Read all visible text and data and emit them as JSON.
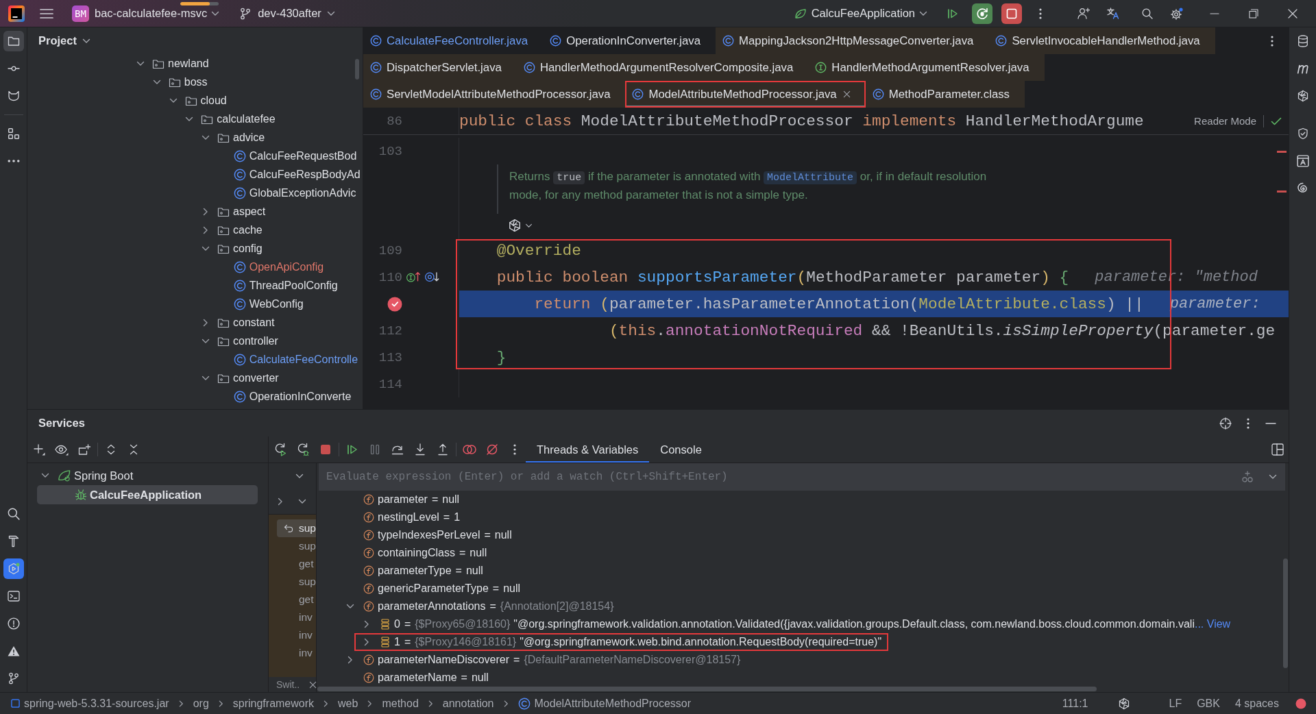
{
  "title_bar": {
    "progress": {
      "level": 0.77
    },
    "project_badge": "BM",
    "project": "bac-calculatefee-msvc",
    "branch": "dev-430after",
    "run_config": "CalcuFeeApplication"
  },
  "left_strip": {
    "top_groups": [
      [
        {
          "kind": "project",
          "selected": true,
          "focused": false
        },
        {
          "kind": "commit",
          "selected": false,
          "focused": false
        },
        {
          "kind": "merge_requests",
          "selected": false,
          "focused": false
        }
      ],
      [
        {
          "kind": "structure",
          "selected": false,
          "focused": false
        },
        {
          "kind": "more",
          "selected": false,
          "focused": false
        }
      ]
    ],
    "bottom": [
      {
        "kind": "search",
        "selected": false,
        "focused": false
      },
      {
        "kind": "build",
        "selected": false,
        "focused": false
      },
      {
        "kind": "services",
        "selected": true,
        "focused": true
      },
      {
        "kind": "terminal",
        "selected": false,
        "focused": false
      },
      {
        "kind": "problems",
        "selected": false,
        "focused": false
      },
      {
        "kind": "warnings",
        "selected": false,
        "focused": false
      },
      {
        "kind": "git",
        "selected": false,
        "focused": false
      }
    ]
  },
  "right_strip": {
    "groups": [
      [
        {
          "kind": "database",
          "selected": false,
          "focused": false
        },
        {
          "kind": "maven",
          "selected": false,
          "focused": false
        },
        {
          "kind": "ai",
          "selected": false,
          "focused": false
        }
      ],
      [
        {
          "kind": "security",
          "selected": false,
          "focused": false
        },
        {
          "kind": "text_box",
          "selected": false,
          "focused": false
        },
        {
          "kind": "spiral",
          "selected": false,
          "focused": false
        }
      ]
    ]
  },
  "project_panel": {
    "title": "Project",
    "tree": [
      {
        "label": "newland",
        "kind": "package",
        "expanded": true,
        "color": "#dfe1e5",
        "children": [
          {
            "label": "boss",
            "kind": "package",
            "expanded": true,
            "color": "#dfe1e5",
            "children": [
              {
                "label": "cloud",
                "kind": "package",
                "expanded": true,
                "color": "#dfe1e5",
                "children": [
                  {
                    "label": "calculatefee",
                    "kind": "package",
                    "expanded": true,
                    "color": "#dfe1e5",
                    "children": [
                      {
                        "label": "advice",
                        "kind": "package",
                        "expanded": true,
                        "color": "#dfe1e5",
                        "children": [
                          {
                            "label": "CalcuFeeRequestBod",
                            "kind": "class",
                            "color": "#dfe1e5"
                          },
                          {
                            "label": "CalcuFeeRespBodyAd",
                            "kind": "class",
                            "color": "#dfe1e5"
                          },
                          {
                            "label": "GlobalExceptionAdvic",
                            "kind": "class",
                            "color": "#dfe1e5"
                          }
                        ]
                      },
                      {
                        "label": "aspect",
                        "kind": "package",
                        "expanded": false,
                        "color": "#dfe1e5"
                      },
                      {
                        "label": "cache",
                        "kind": "package",
                        "expanded": false,
                        "color": "#dfe1e5"
                      },
                      {
                        "label": "config",
                        "kind": "package",
                        "expanded": true,
                        "color": "#dfe1e5",
                        "children": [
                          {
                            "label": "OpenApiConfig",
                            "kind": "class",
                            "color": "#e0776a"
                          },
                          {
                            "label": "ThreadPoolConfig",
                            "kind": "class",
                            "color": "#dfe1e5"
                          },
                          {
                            "label": "WebConfig",
                            "kind": "class",
                            "color": "#dfe1e5"
                          }
                        ]
                      },
                      {
                        "label": "constant",
                        "kind": "package",
                        "expanded": false,
                        "color": "#dfe1e5"
                      },
                      {
                        "label": "controller",
                        "kind": "package",
                        "expanded": true,
                        "color": "#dfe1e5",
                        "children": [
                          {
                            "label": "CalculateFeeControlle",
                            "kind": "class",
                            "color": "#6d9ff7"
                          }
                        ]
                      },
                      {
                        "label": "converter",
                        "kind": "package",
                        "expanded": true,
                        "color": "#dfe1e5",
                        "children": [
                          {
                            "label": "OperationInConverte",
                            "kind": "class",
                            "color": "#dfe1e5"
                          }
                        ]
                      }
                    ]
                  }
                ]
              }
            ]
          }
        ]
      }
    ]
  },
  "editor": {
    "tab_rows": [
      [
        {
          "label": "CalculateFeeController.java",
          "kind": "class",
          "selected": false,
          "library": false,
          "modified": true,
          "highlighted": false
        },
        {
          "label": "OperationInConverter.java",
          "kind": "class",
          "selected": false,
          "library": false,
          "modified": false,
          "highlighted": false
        },
        {
          "label": "MappingJackson2HttpMessageConverter.java",
          "kind": "class",
          "selected": false,
          "library": true,
          "modified": false,
          "highlighted": false
        },
        {
          "label": "ServletInvocableHandlerMethod.java",
          "kind": "class",
          "selected": false,
          "library": true,
          "modified": false,
          "highlighted": false
        }
      ],
      [
        {
          "label": "DispatcherServlet.java",
          "kind": "class",
          "selected": false,
          "library": true,
          "modified": false,
          "highlighted": false
        },
        {
          "label": "HandlerMethodArgumentResolverComposite.java",
          "kind": "class",
          "selected": false,
          "library": true,
          "modified": false,
          "highlighted": false
        },
        {
          "label": "HandlerMethodArgumentResolver.java",
          "kind": "interface",
          "selected": false,
          "library": true,
          "modified": false,
          "highlighted": false
        }
      ],
      [
        {
          "label": "ServletModelAttributeMethodProcessor.java",
          "kind": "class",
          "selected": false,
          "library": true,
          "modified": false,
          "highlighted": false
        },
        {
          "label": "ModelAttributeMethodProcessor.java",
          "kind": "class",
          "selected": true,
          "library": true,
          "modified": false,
          "highlighted": true
        },
        {
          "label": "MethodParameter.class",
          "kind": "class",
          "selected": false,
          "library": true,
          "modified": false,
          "highlighted": false
        }
      ]
    ],
    "sticky_line": {
      "number": "86",
      "tokens": [
        {
          "kind": "keyword",
          "text": "public class "
        },
        {
          "kind": "plain",
          "text": "ModelAttributeMethodProcessor "
        },
        {
          "kind": "keyword",
          "text": "implements "
        },
        {
          "kind": "plain",
          "text": "HandlerMethodArgume"
        }
      ]
    },
    "reader_mode": "Reader Mode",
    "lines": [
      {
        "kind": "code",
        "number": "103",
        "boxed": false,
        "current": false,
        "breakpoint": false
      },
      {
        "kind": "doc",
        "segments": [
          {
            "kind": "text",
            "text": "Returns "
          },
          {
            "kind": "code",
            "text": "true"
          },
          {
            "kind": "text",
            "text": " if the parameter is annotated with "
          },
          {
            "kind": "code_link",
            "text": "ModelAttribute"
          },
          {
            "kind": "text",
            "text": " or, if in default resolution mode, for any method parameter that is not a simple type."
          }
        ]
      },
      {
        "kind": "doc_actions"
      },
      {
        "kind": "code",
        "number": "109",
        "boxed": true,
        "current": false,
        "breakpoint": false,
        "tokens": [
          {
            "kind": "annotation",
            "text": "    @Override"
          }
        ]
      },
      {
        "kind": "code",
        "number": "110",
        "boxed": true,
        "current": false,
        "breakpoint": false,
        "gutter_icons": [
          {
            "kind": "implements"
          },
          {
            "kind": "annotated"
          }
        ],
        "tokens": [
          {
            "kind": "keyword",
            "text": "    public boolean "
          },
          {
            "kind": "method",
            "text": "supportsParameter"
          },
          {
            "kind": "paren",
            "text": "("
          },
          {
            "kind": "plain",
            "text": "MethodParameter parameter"
          },
          {
            "kind": "paren",
            "text": ")"
          },
          {
            "kind": "brace",
            "text": " {"
          }
        ],
        "hint": "parameter: \"method"
      },
      {
        "kind": "code",
        "boxed": true,
        "current": true,
        "breakpoint": true,
        "tokens": [
          {
            "kind": "keyword",
            "text": "        return "
          },
          {
            "kind": "paren",
            "text": "("
          },
          {
            "kind": "plain",
            "text": "parameter.hasParameterAnnotation("
          },
          {
            "kind": "annotation",
            "text": "ModelAttribute.class"
          },
          {
            "kind": "plain",
            "text": ") ||"
          }
        ],
        "hint": "parameter:"
      },
      {
        "kind": "code",
        "number": "112",
        "boxed": true,
        "current": false,
        "breakpoint": false,
        "tokens": [
          {
            "kind": "paren",
            "text": "                ("
          },
          {
            "kind": "keyword",
            "text": "this"
          },
          {
            "kind": "plain",
            "text": "."
          },
          {
            "kind": "field",
            "text": "annotationNotRequired"
          },
          {
            "kind": "plain",
            "text": " && !BeanUtils."
          },
          {
            "kind": "static",
            "text": "isSimpleProperty"
          },
          {
            "kind": "plain",
            "text": "(parameter.ge"
          }
        ]
      },
      {
        "kind": "code",
        "number": "113",
        "boxed": true,
        "current": false,
        "breakpoint": false,
        "tokens": [
          {
            "kind": "brace",
            "text": "    }"
          }
        ]
      },
      {
        "kind": "code",
        "number": "114",
        "boxed": false,
        "current": false,
        "breakpoint": false
      }
    ]
  },
  "services": {
    "title": "Services",
    "tree": [
      {
        "label": "Spring Boot",
        "kind": "spring_boot",
        "expanded": true,
        "selected": false,
        "children": [
          {
            "label": "CalcuFeeApplication",
            "kind": "debug_app",
            "selected": true
          }
        ]
      }
    ],
    "debugger": {
      "tabs": [
        {
          "label": "Threads & Variables",
          "selected": true
        },
        {
          "label": "Console",
          "selected": false
        }
      ],
      "frames": [
        {
          "label": "sup",
          "selected": true
        },
        {
          "label": "sup",
          "selected": false
        },
        {
          "label": "get",
          "selected": false
        },
        {
          "label": "sup",
          "selected": false
        },
        {
          "label": "get",
          "selected": false
        },
        {
          "label": "inv",
          "selected": false
        },
        {
          "label": "inv",
          "selected": false
        },
        {
          "label": "inv",
          "selected": false
        }
      ],
      "frames_hint": "Swit..",
      "evaluate": {
        "placeholder": "Evaluate expression (Enter) or add a watch (Ctrl+Shift+Enter)"
      },
      "variables": [
        {
          "kind": "field",
          "name": "parameter",
          "operator": "=",
          "value": "null",
          "highlighted": false
        },
        {
          "kind": "field",
          "name": "nestingLevel",
          "operator": "=",
          "value": "1",
          "highlighted": false
        },
        {
          "kind": "field",
          "name": "typeIndexesPerLevel",
          "operator": "=",
          "value": "null",
          "highlighted": false
        },
        {
          "kind": "field",
          "name": "containingClass",
          "operator": "=",
          "value": "null",
          "highlighted": false
        },
        {
          "kind": "field",
          "name": "parameterType",
          "operator": "=",
          "value": "null",
          "highlighted": false
        },
        {
          "kind": "field",
          "name": "genericParameterType",
          "operator": "=",
          "value": "null",
          "highlighted": false
        },
        {
          "kind": "field",
          "name": "parameterAnnotations",
          "operator": "=",
          "type_info": "{Annotation[2]@18154}",
          "expanded": true,
          "highlighted": false,
          "children": [
            {
              "kind": "element",
              "name": "0",
              "operator": "=",
              "type_info": "{$Proxy65@18160}",
              "value": "\"@org.springframework.validation.annotation.Validated({javax.validation.groups.Default.class, com.newland.boss.cloud.common.domain.vali",
              "link": "... View",
              "expanded": false,
              "highlighted": false
            },
            {
              "kind": "element",
              "name": "1",
              "operator": "=",
              "type_info": "{$Proxy146@18161}",
              "value": "\"@org.springframework.web.bind.annotation.RequestBody(required=true)\"",
              "expanded": false,
              "highlighted": true
            }
          ]
        },
        {
          "kind": "field",
          "name": "parameterNameDiscoverer",
          "operator": "=",
          "type_info": "{DefaultParameterNameDiscoverer@18157}",
          "expanded": false,
          "highlighted": false
        },
        {
          "kind": "field",
          "name": "parameterName",
          "operator": "=",
          "value": "null",
          "highlighted": false
        }
      ]
    }
  },
  "status_bar": {
    "breadcrumbs": [
      {
        "kind": "jar",
        "label": "spring-web-5.3.31-sources.jar"
      },
      {
        "kind": "package",
        "label": "org"
      },
      {
        "kind": "package",
        "label": "springframework"
      },
      {
        "kind": "package",
        "label": "web"
      },
      {
        "kind": "package",
        "label": "method"
      },
      {
        "kind": "package",
        "label": "annotation"
      },
      {
        "kind": "class",
        "label": "ModelAttributeMethodProcessor"
      }
    ],
    "caret_position": "111:1",
    "line_separator": "LF",
    "encoding": "GBK",
    "indent": "4 spaces"
  }
}
